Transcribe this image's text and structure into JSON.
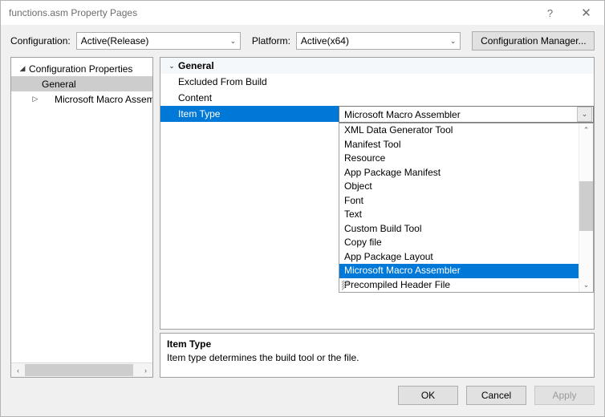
{
  "window": {
    "title": "functions.asm Property Pages",
    "help_label": "?",
    "close_label": "✕"
  },
  "config_bar": {
    "configuration_label": "Configuration:",
    "configuration_value": "Active(Release)",
    "platform_label": "Platform:",
    "platform_value": "Active(x64)",
    "configuration_manager_label": "Configuration Manager...",
    "dropdown_arrow": "⌄"
  },
  "tree": {
    "nodes": [
      {
        "label": "Configuration Properties",
        "level": 1,
        "twisty": "◢",
        "selected": false
      },
      {
        "label": "General",
        "level": 2,
        "twisty": "",
        "selected": true
      },
      {
        "label": "Microsoft Macro Assemble",
        "level": 2,
        "twisty": "▷",
        "selected": false
      }
    ],
    "scroll_left_arrow": "‹",
    "scroll_right_arrow": "›"
  },
  "grid": {
    "category": {
      "label": "General",
      "twisty": "⌄"
    },
    "rows": [
      {
        "name": "Excluded From Build",
        "value": "",
        "selected": false
      },
      {
        "name": "Content",
        "value": "",
        "selected": false
      },
      {
        "name": "Item Type",
        "value": "Microsoft Macro Assembler",
        "selected": true
      }
    ]
  },
  "editor": {
    "value": "Microsoft Macro Assembler",
    "arrow": "⌄"
  },
  "dropdown": {
    "up_arrow": "⌃",
    "down_arrow": "⌄",
    "items": [
      {
        "label": "XML Data Generator Tool",
        "selected": false
      },
      {
        "label": "Manifest Tool",
        "selected": false
      },
      {
        "label": "Resource",
        "selected": false
      },
      {
        "label": "App Package Manifest",
        "selected": false
      },
      {
        "label": "Object",
        "selected": false
      },
      {
        "label": "Font",
        "selected": false
      },
      {
        "label": "Text",
        "selected": false
      },
      {
        "label": "Custom Build Tool",
        "selected": false
      },
      {
        "label": "Copy file",
        "selected": false
      },
      {
        "label": "App Package Layout",
        "selected": false
      },
      {
        "label": "Microsoft Macro Assembler",
        "selected": true
      },
      {
        "label": "Precompiled Header File",
        "selected": false
      }
    ]
  },
  "description": {
    "title": "Item Type",
    "text": "Item type determines the build tool or the file."
  },
  "footer": {
    "ok_label": "OK",
    "cancel_label": "Cancel",
    "apply_label": "Apply"
  },
  "colors": {
    "accent": "#0078d7",
    "tree_selection": "#cdcdcd",
    "dialog_background": "#f0f0f0"
  }
}
